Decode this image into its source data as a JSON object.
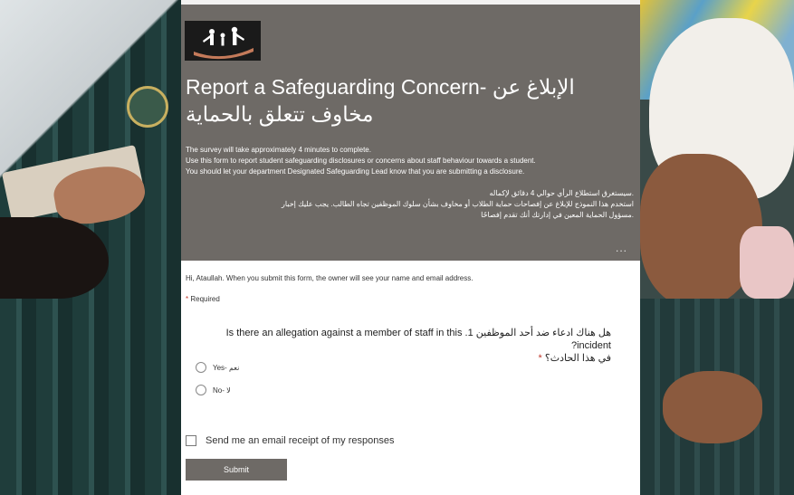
{
  "form": {
    "title": "Report a Safeguarding Concern- الإبلاغ عن مخاوف تتعلق بالحماية",
    "description_en": [
      "The survey will take approximately 4 minutes to complete.",
      "Use this form to report student safeguarding disclosures or concerns about staff behaviour towards a student.",
      "You should let your department Designated Safeguarding Lead know that you are submitting a disclosure."
    ],
    "description_ar": [
      ".سيستغرق استطلاع الرأي حوالي 4 دقائق لإكماله",
      "استخدم هذا النموذج للإبلاغ عن إفصاحات حماية الطلاب أو مخاوف بشأن سلوك الموظفين تجاه الطالب. يجب عليك إخبار",
      ".مسؤول الحماية المعين في إدارتك أنك تقدم إفصاحًا"
    ],
    "more_label": "...",
    "identity_notice": "Hi, Ataullah. When you submit this form, the owner will see your name and email address.",
    "required_star": "*",
    "required_label": "Required",
    "question": {
      "text_en": "1. Is there an allegation against a member of staff in this incident?",
      "text_ar_1": "هل هناك ادعاء ضد أحد الموظفين",
      "text_ar_2": "في هذا الحادث؟",
      "star": "*",
      "options": [
        "Yes- نعم",
        "No- لا"
      ]
    },
    "receipt_label": "Send me an email receipt of my responses",
    "submit_label": "Submit"
  },
  "colors": {
    "header_bg": "#6e6a66",
    "required_star": "#c0392b"
  }
}
